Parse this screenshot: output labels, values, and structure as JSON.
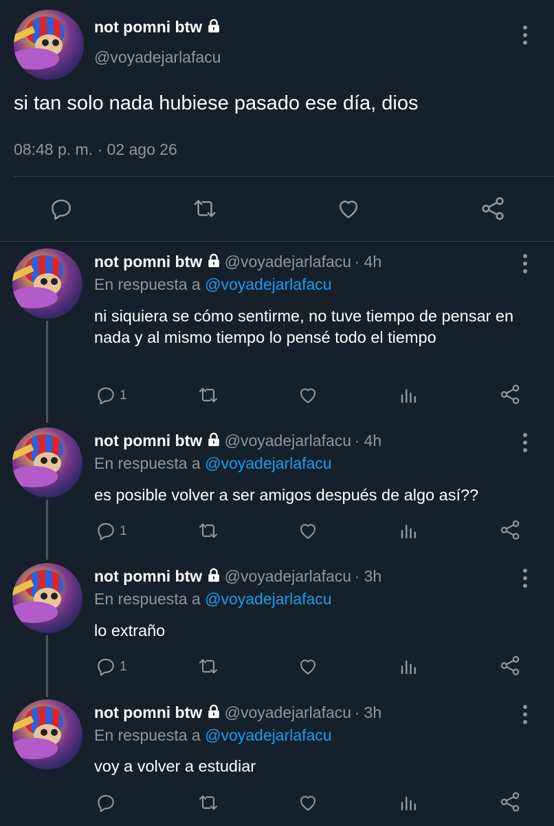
{
  "main_tweet": {
    "name": "not pomni btw",
    "handle": "@voyadejarlafacu",
    "text": "si tan solo nada hubiese pasado ese día, dios",
    "time": "08:48 p. m.",
    "separator": "·",
    "date": "02 ago 26",
    "actions": [
      "reply-icon",
      "retweet-icon",
      "like-icon",
      "share-icon"
    ]
  },
  "replies": [
    {
      "name": "not pomni btw",
      "handle": "@voyadejarlafacu",
      "age": "· 4h",
      "reply_prefix": "En respuesta a",
      "reply_to": "@voyadejarlafacu",
      "text": "ni siquiera se cómo sentirme, no tuve tiempo de pensar en nada y al mismo tiempo lo pensé todo el tiempo",
      "reply_count": "1"
    },
    {
      "name": "not pomni btw",
      "handle": "@voyadejarlafacu",
      "age": "· 4h",
      "reply_prefix": "En respuesta a",
      "reply_to": "@voyadejarlafacu",
      "text": "es posible volver a ser amigos después de algo así??",
      "reply_count": "1"
    },
    {
      "name": "not pomni btw",
      "handle": "@voyadejarlafacu",
      "age": "· 3h",
      "reply_prefix": "En respuesta a",
      "reply_to": "@voyadejarlafacu",
      "text": "lo extraño",
      "reply_count": "1"
    },
    {
      "name": "not pomni btw",
      "handle": "@voyadejarlafacu",
      "age": "· 3h",
      "reply_prefix": "En respuesta a",
      "reply_to": "@voyadejarlafacu",
      "text": "voy a volver a estudiar",
      "reply_count": ""
    }
  ],
  "colors": {
    "background": "#15202b",
    "muted": "#8899a6",
    "link": "#1d9bf0",
    "divider": "#38444d"
  }
}
